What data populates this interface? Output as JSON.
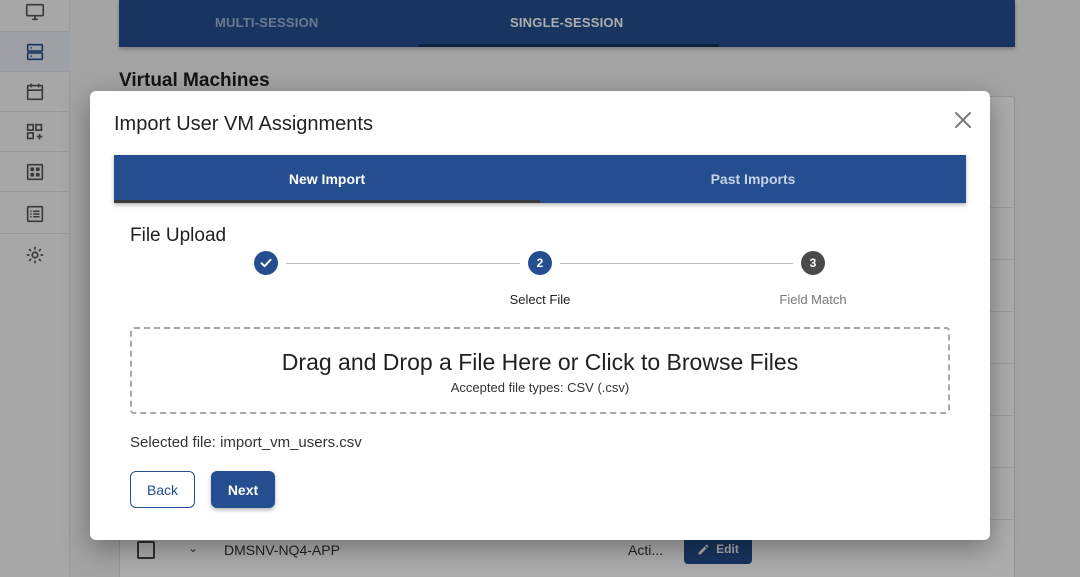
{
  "session_tabs": {
    "multi": "MULTI-SESSION",
    "single": "SINGLE-SESSION"
  },
  "vm_section": {
    "heading": "Virtual Machines",
    "row": {
      "name": "DMSNV-NQ4-APP",
      "status": "Acti...",
      "edit_label": "Edit"
    }
  },
  "sidebar": {
    "items": [
      {
        "icon": "monitor-icon"
      },
      {
        "icon": "server-icon"
      },
      {
        "icon": "calendar-icon"
      },
      {
        "icon": "linked-apps-icon"
      },
      {
        "icon": "grid-icon"
      },
      {
        "icon": "list-icon"
      },
      {
        "icon": "settings-icon"
      }
    ]
  },
  "modal": {
    "title": "Import User VM Assignments",
    "tabs": {
      "new_import": "New Import",
      "past_imports": "Past Imports"
    },
    "section_title": "File Upload",
    "stepper": {
      "steps": [
        {
          "number": "1",
          "label": "",
          "state": "completed"
        },
        {
          "number": "2",
          "label": "Select File",
          "state": "active"
        },
        {
          "number": "3",
          "label": "Field Match",
          "state": "pending"
        }
      ]
    },
    "dropzone": {
      "main": "Drag and Drop a File Here or Click to Browse Files",
      "sub": "Accepted file types: CSV (.csv)"
    },
    "selected_file": {
      "label": "Selected file:",
      "name": "import_vm_users.csv"
    },
    "buttons": {
      "back": "Back",
      "next": "Next"
    }
  },
  "colors": {
    "primary": "#244e8f",
    "inactive_step": "#4a4a4a"
  }
}
